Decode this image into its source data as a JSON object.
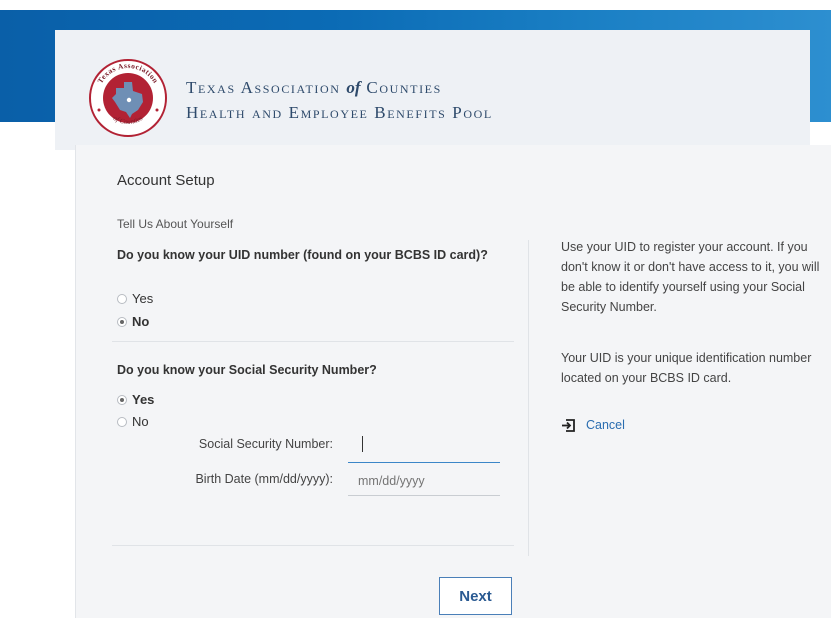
{
  "org": {
    "line1_part1": "Texas Association",
    "line1_of": "of",
    "line1_part2": "Counties",
    "line2": "Health and Employee Benefits Pool",
    "seal_top_text": "Texas Association",
    "seal_bottom_text": "of Counties"
  },
  "form": {
    "title": "Account Setup",
    "subtitle": "Tell Us About Yourself",
    "q1": {
      "text": "Do you know your UID number (found on your BCBS ID card)?",
      "options": [
        {
          "label": "Yes",
          "checked": false
        },
        {
          "label": "No",
          "checked": true
        }
      ]
    },
    "q2": {
      "text": "Do you know your Social Security Number?",
      "options": [
        {
          "label": "Yes",
          "checked": true
        },
        {
          "label": "No",
          "checked": false
        }
      ]
    },
    "ssn_label": "Social Security Number:",
    "ssn_value": "",
    "birth_label": "Birth Date (mm/dd/yyyy):",
    "birth_placeholder": "mm/dd/yyyy",
    "next_label": "Next"
  },
  "help": {
    "paragraph1": "Use your UID to register your account. If you don't know it or don't have access to it, you will be able to identify yourself using your Social Security Number.",
    "paragraph2": "Your UID is your unique identification number located on your BCBS ID card.",
    "cancel_label": "Cancel"
  },
  "colors": {
    "brand_blue": "#0b6bb5",
    "seal_red": "#b22234",
    "link": "#2a6db0"
  }
}
